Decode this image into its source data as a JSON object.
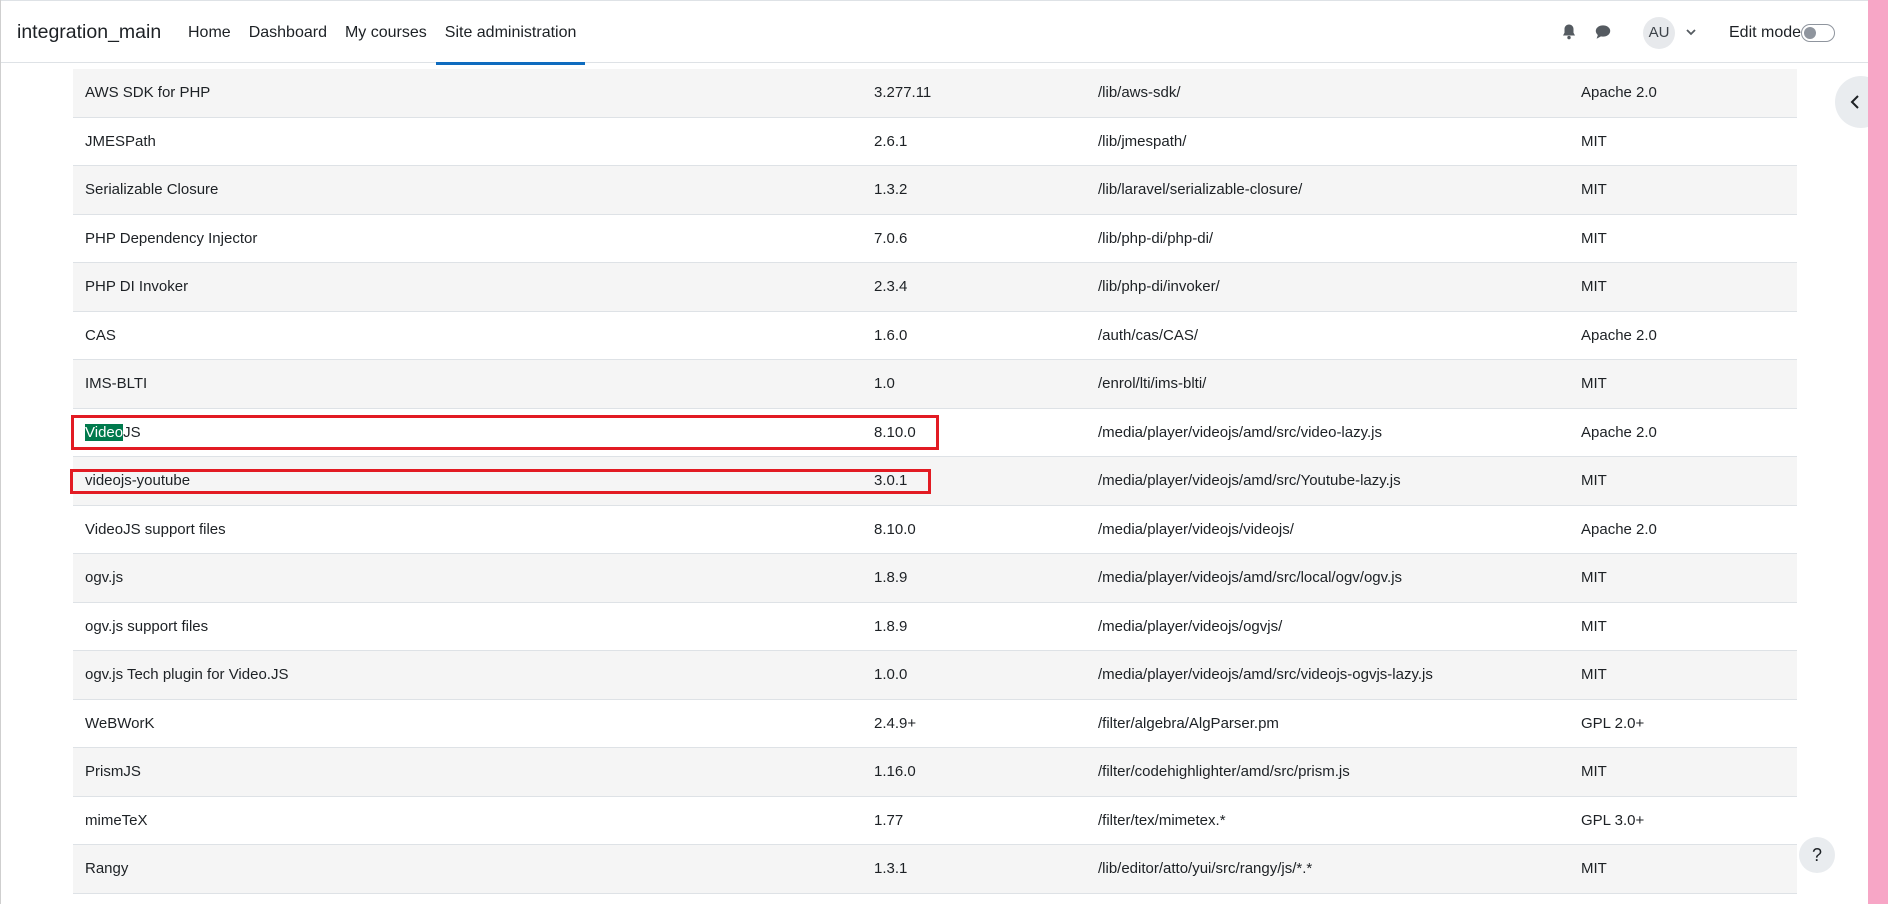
{
  "navbar": {
    "brand": "integration_main",
    "links": [
      {
        "label": "Home",
        "active": false
      },
      {
        "label": "Dashboard",
        "active": false
      },
      {
        "label": "My courses",
        "active": false
      },
      {
        "label": "Site administration",
        "active": true
      }
    ],
    "avatar_initials": "AU",
    "edit_mode_label": "Edit mode",
    "edit_mode_on": false
  },
  "colors": {
    "accent": "#0f6cbf",
    "highlight_box": "#e21b23",
    "search_highlight": "#007a4d"
  },
  "help_label": "?",
  "table": {
    "rows": [
      {
        "name": "AWS SDK for PHP",
        "version": "3.277.11",
        "location": "/lib/aws-sdk/",
        "license": "Apache 2.0"
      },
      {
        "name": "JMESPath",
        "version": "2.6.1",
        "location": "/lib/jmespath/",
        "license": "MIT"
      },
      {
        "name": "Serializable Closure",
        "version": "1.3.2",
        "location": "/lib/laravel/serializable-closure/",
        "license": "MIT"
      },
      {
        "name": "PHP Dependency Injector",
        "version": "7.0.6",
        "location": "/lib/php-di/php-di/",
        "license": "MIT"
      },
      {
        "name": "PHP DI Invoker",
        "version": "2.3.4",
        "location": "/lib/php-di/invoker/",
        "license": "MIT"
      },
      {
        "name": "CAS",
        "version": "1.6.0",
        "location": "/auth/cas/CAS/",
        "license": "Apache 2.0"
      },
      {
        "name": "IMS-BLTI",
        "version": "1.0",
        "location": "/enrol/lti/ims-blti/",
        "license": "MIT"
      },
      {
        "name": "VideoJS",
        "name_highlight": "Video",
        "name_rest": "JS",
        "version": "8.10.0",
        "location": "/media/player/videojs/amd/src/video-lazy.js",
        "license": "Apache 2.0"
      },
      {
        "name": "videojs-youtube",
        "version": "3.0.1",
        "location": "/media/player/videojs/amd/src/Youtube-lazy.js",
        "license": "MIT"
      },
      {
        "name": "VideoJS support files",
        "version": "8.10.0",
        "location": "/media/player/videojs/videojs/",
        "license": "Apache 2.0"
      },
      {
        "name": "ogv.js",
        "version": "1.8.9",
        "location": "/media/player/videojs/amd/src/local/ogv/ogv.js",
        "license": "MIT"
      },
      {
        "name": "ogv.js support files",
        "version": "1.8.9",
        "location": "/media/player/videojs/ogvjs/",
        "license": "MIT"
      },
      {
        "name": "ogv.js Tech plugin for Video.JS",
        "version": "1.0.0",
        "location": "/media/player/videojs/amd/src/videojs-ogvjs-lazy.js",
        "license": "MIT"
      },
      {
        "name": "WeBWorK",
        "version": "2.4.9+",
        "location": "/filter/algebra/AlgParser.pm",
        "license": "GPL 2.0+"
      },
      {
        "name": "PrismJS",
        "version": "1.16.0",
        "location": "/filter/codehighlighter/amd/src/prism.js",
        "license": "MIT"
      },
      {
        "name": "mimeTeX",
        "version": "1.77",
        "location": "/filter/tex/mimetex.*",
        "license": "GPL 3.0+"
      },
      {
        "name": "Rangy",
        "version": "1.3.1",
        "location": "/lib/editor/atto/yui/src/rangy/js/*.*",
        "license": "MIT"
      }
    ]
  }
}
